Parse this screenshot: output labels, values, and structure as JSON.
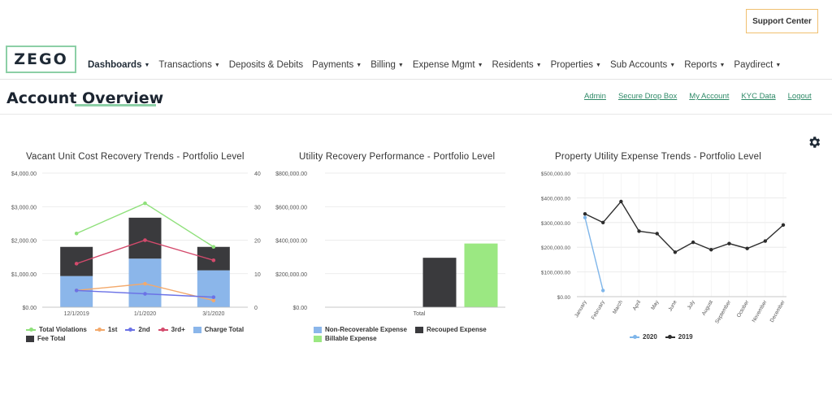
{
  "support": {
    "label": "Support Center"
  },
  "logo": {
    "text": "ZEGO"
  },
  "nav": [
    {
      "label": "Dashboards",
      "caret": true,
      "active": true
    },
    {
      "label": "Transactions",
      "caret": true
    },
    {
      "label": "Deposits & Debits",
      "caret": false
    },
    {
      "label": "Payments",
      "caret": true
    },
    {
      "label": "Billing",
      "caret": true
    },
    {
      "label": "Expense Mgmt",
      "caret": true
    },
    {
      "label": "Residents",
      "caret": true
    },
    {
      "label": "Properties",
      "caret": true
    },
    {
      "label": "Sub Accounts",
      "caret": true
    },
    {
      "label": "Reports",
      "caret": true
    },
    {
      "label": "Paydirect",
      "caret": true
    }
  ],
  "page": {
    "title": "Account Overview"
  },
  "toplinks": [
    "Admin",
    "Secure Drop Box",
    "My Account",
    "KYC Data",
    "Logout"
  ],
  "icons": {
    "settings": "gear-icon",
    "nav_caret": "caret-down-icon"
  },
  "colors": {
    "brand_green": "#8ccfa6",
    "link_green": "#2f8a68",
    "support_border": "#f0c070",
    "charge_total": "#8bb6ea",
    "fee_total": "#3a3a3d",
    "total_violations": "#8fe07b",
    "first": "#f3a96b",
    "second": "#6b72e6",
    "third_plus": "#d44a6c",
    "non_recoverable": "#8bb6ea",
    "recouped": "#3a3a3d",
    "billable": "#9be882",
    "y2020": "#7fb6ea",
    "y2019": "#2d2d2d"
  },
  "chart_data": [
    {
      "type": "bar",
      "title": "Vacant Unit Cost Recovery Trends - Portfolio Level",
      "categories": [
        "12/1/2019",
        "1/1/2020",
        "3/1/2020"
      ],
      "y_left": {
        "lim": [
          0,
          4000
        ],
        "ticks": [
          "$0.00",
          "$1,000.00",
          "$2,000.00",
          "$3,000.00",
          "$4,000.00"
        ]
      },
      "y_right": {
        "lim": [
          0,
          40
        ],
        "ticks": [
          "0",
          "10",
          "20",
          "30",
          "40"
        ]
      },
      "stacked_bars": [
        {
          "name": "Charge Total",
          "values": [
            930,
            1450,
            1100
          ]
        },
        {
          "name": "Fee Total",
          "values": [
            870,
            1220,
            700
          ]
        }
      ],
      "lines": [
        {
          "name": "Total Violations",
          "values": [
            22,
            31,
            18
          ]
        },
        {
          "name": "1st",
          "values": [
            5,
            7,
            2
          ]
        },
        {
          "name": "2nd",
          "values": [
            5,
            4,
            3
          ]
        },
        {
          "name": "3rd+",
          "values": [
            13,
            20,
            14
          ]
        }
      ],
      "legend": [
        "Total Violations",
        "1st",
        "2nd",
        "3rd+",
        "Charge Total",
        "Fee Total"
      ],
      "legend_placement": "bottom-left",
      "grid": true
    },
    {
      "type": "bar",
      "title": "Utility Recovery Performance - Portfolio Level",
      "categories": [
        "Total"
      ],
      "ylim": [
        0,
        800000
      ],
      "y_ticks": [
        "$0.00",
        "$200,000.00",
        "$400,000.00",
        "$600,000.00",
        "$800,000.00"
      ],
      "series": [
        {
          "name": "Non-Recoverable Expense",
          "values": [
            0
          ]
        },
        {
          "name": "Recouped Expense",
          "values": [
            295000
          ]
        },
        {
          "name": "Billable Expense",
          "values": [
            380000
          ]
        }
      ],
      "legend": [
        "Non-Recoverable Expense",
        "Recouped Expense",
        "Billable Expense"
      ],
      "legend_placement": "bottom-left",
      "grid": true
    },
    {
      "type": "line",
      "title": "Property Utility Expense Trends - Portfolio Level",
      "x": [
        "January",
        "February",
        "March",
        "April",
        "May",
        "June",
        "July",
        "August",
        "September",
        "October",
        "November",
        "December"
      ],
      "ylim": [
        0,
        500000
      ],
      "y_ticks": [
        "$0.00",
        "$100,000.00",
        "$200,000.00",
        "$300,000.00",
        "$400,000.00",
        "$500,000.00"
      ],
      "series": [
        {
          "name": "2020",
          "values": [
            320000,
            25000
          ]
        },
        {
          "name": "2019",
          "values": [
            335000,
            300000,
            385000,
            265000,
            255000,
            180000,
            220000,
            190000,
            215000,
            195000,
            225000,
            290000
          ]
        }
      ],
      "legend": [
        "2020",
        "2019"
      ],
      "legend_placement": "bottom-center",
      "grid": true
    }
  ]
}
